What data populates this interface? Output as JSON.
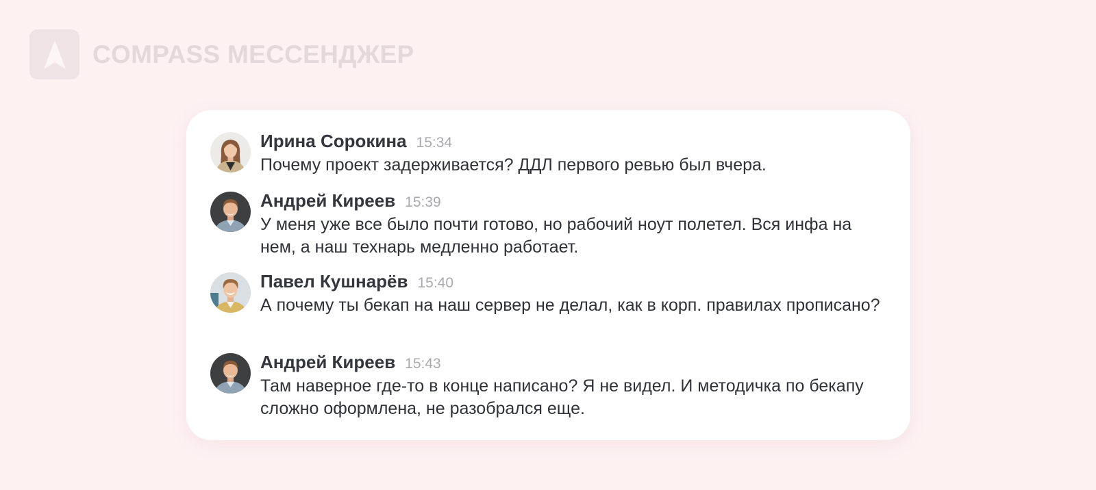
{
  "app": {
    "brand_title": "COMPASS МЕССЕНДЖЕР",
    "logo_icon": "compass-logo-icon"
  },
  "colors": {
    "background": "#fdf1f2",
    "card": "#ffffff",
    "author": "#33363d",
    "time": "#a9a9ae",
    "text": "#2f3238",
    "brand_text": "#e4d8da"
  },
  "messages": [
    {
      "author": "Ирина Сорокина",
      "time": "15:34",
      "text": "Почему проект задерживается? ДДЛ первого ревью был вчера.",
      "avatar": "avatar-irina-sorokina"
    },
    {
      "author": "Андрей Киреев",
      "time": "15:39",
      "text": "У меня уже все было почти готово, но рабочий ноут полетел. Вся инфа на нем, а наш технарь медленно работает.",
      "avatar": "avatar-andrey-kireev"
    },
    {
      "author": "Павел Кушнарёв",
      "time": "15:40",
      "text": "А почему ты бекап на наш сервер не делал, как в корп. правилах прописано?",
      "avatar": "avatar-pavel-kushnarev"
    },
    {
      "author": "Андрей Киреев",
      "time": "15:43",
      "text": "Там наверное где-то в конце написано? Я не видел. И методичка по бекапу сложно оформлена, не разобрался еще.",
      "avatar": "avatar-andrey-kireev"
    }
  ]
}
